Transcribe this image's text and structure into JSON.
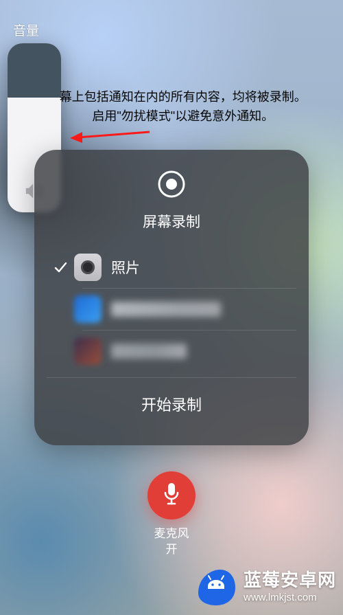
{
  "volume": {
    "label": "音量",
    "icon": "speaker-wave-icon",
    "level_percent": 68
  },
  "notice": {
    "line1": "幕上包括通知在内的所有内容，均将被录制。",
    "line2": "启用\"勿扰模式\"以避免意外通知。"
  },
  "panel": {
    "title": "屏幕录制",
    "destinations": [
      {
        "name": "照片",
        "selected": true,
        "icon": "camera-icon"
      },
      {
        "name": "",
        "selected": false,
        "icon": "app-icon-blur-1",
        "pixelated": true
      },
      {
        "name": "",
        "selected": false,
        "icon": "app-icon-blur-2",
        "pixelated": true
      }
    ],
    "start_label": "开始录制"
  },
  "mic": {
    "line1": "麦克风",
    "line2": "开",
    "color": "#e13e38"
  },
  "watermark": {
    "title": "蓝莓安卓网",
    "url": "www.lmkjst.com"
  }
}
